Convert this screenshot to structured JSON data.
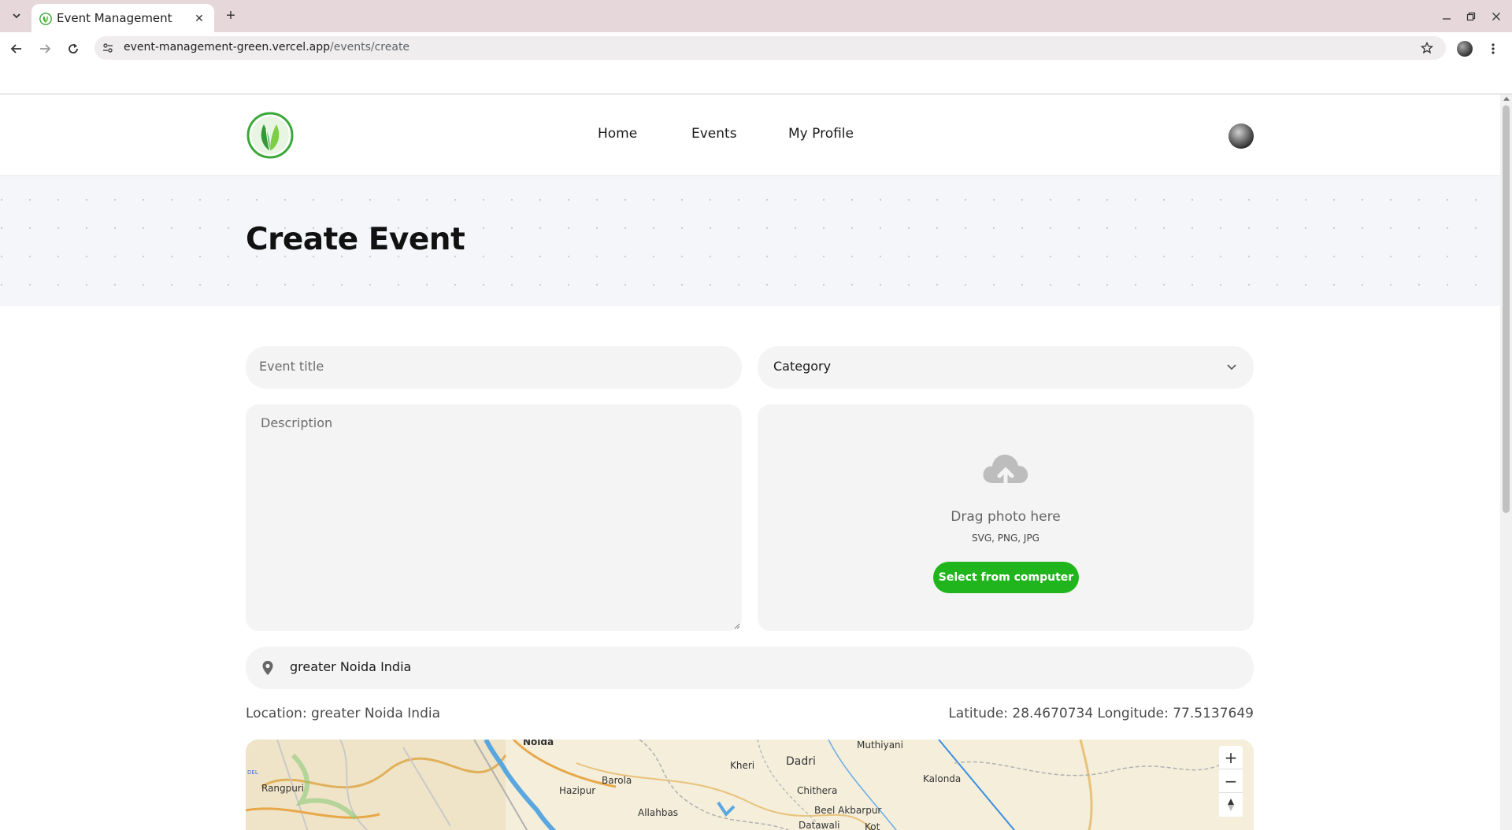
{
  "browser": {
    "tab_title": "Event Management",
    "url_host": "event-management-green.vercel.app",
    "url_path": "/events/create"
  },
  "nav": {
    "items": [
      {
        "label": "Home"
      },
      {
        "label": "Events"
      },
      {
        "label": "My Profile"
      }
    ]
  },
  "page": {
    "title": "Create Event"
  },
  "form": {
    "title_placeholder": "Event title",
    "category_label": "Category",
    "description_placeholder": "Description",
    "upload": {
      "drag_text": "Drag photo here",
      "formats": "SVG, PNG, JPG",
      "button_label": "Select from computer"
    },
    "location_value": "greater Noida India",
    "location_caption": "Location: greater Noida India",
    "coords_caption": "Latitude: 28.4670734 Longitude: 77.5137649"
  },
  "map": {
    "labels": [
      "Noida",
      "Rangpuri",
      "Hazipur",
      "Barola",
      "Allahbas",
      "Kheri",
      "Dadri",
      "Chithera",
      "Beel Akbarpur",
      "Datawali",
      "Kot",
      "Muthiyani",
      "Kalonda",
      "DEL"
    ],
    "zoom_in": "+",
    "zoom_out": "−"
  },
  "colors": {
    "accent_green": "#20b51c",
    "field_bg": "#f4f4f4"
  }
}
